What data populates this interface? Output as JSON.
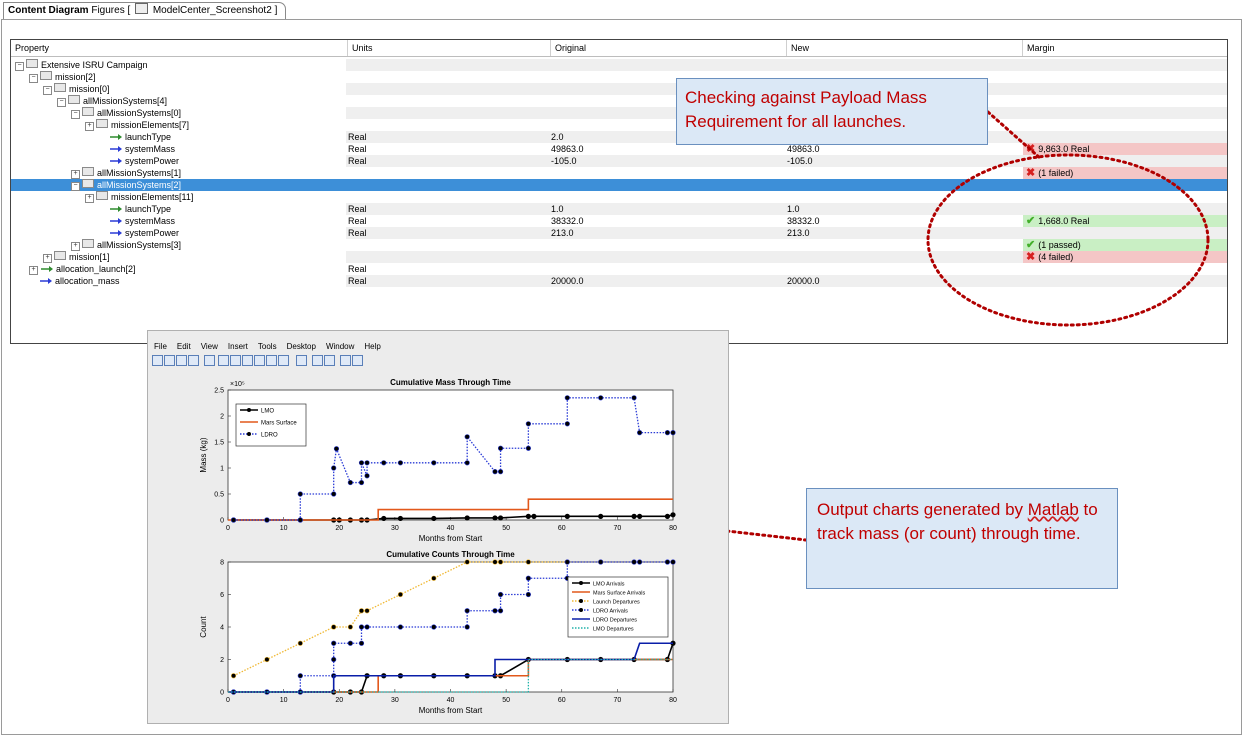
{
  "tab": {
    "bold_label": "Content Diagram",
    "label": "Figures [",
    "doc_name": "ModelCenter_Screenshot2",
    "close": "]"
  },
  "table": {
    "columns": [
      "Property",
      "Units",
      "Original",
      "New",
      "Margin"
    ],
    "rows": [
      {
        "label": "Extensive ISRU Campaign",
        "units": "",
        "original": "",
        "new": "",
        "margin": ""
      },
      {
        "label": "mission[2]",
        "units": "",
        "original": "",
        "new": "",
        "margin": ""
      },
      {
        "label": "mission[0]",
        "units": "",
        "original": "",
        "new": "",
        "margin": ""
      },
      {
        "label": "allMissionSystems[4]",
        "units": "",
        "original": "",
        "new": "",
        "margin": ""
      },
      {
        "label": "allMissionSystems[0]",
        "units": "",
        "original": "",
        "new": "",
        "margin": ""
      },
      {
        "label": "missionElements[7]",
        "units": "",
        "original": "",
        "new": "",
        "margin": ""
      },
      {
        "label": "launchType",
        "units": "Real",
        "original": "2.0",
        "new": "2.0",
        "margin": ""
      },
      {
        "label": "systemMass",
        "units": "Real",
        "original": "49863.0",
        "new": "49863.0",
        "margin": "9,863.0 Real"
      },
      {
        "label": "systemPower",
        "units": "Real",
        "original": "-105.0",
        "new": "-105.0",
        "margin": ""
      },
      {
        "label": "allMissionSystems[1]",
        "units": "",
        "original": "",
        "new": "",
        "margin": "(1 failed)"
      },
      {
        "label": "allMissionSystems[2]",
        "units": "",
        "original": "",
        "new": "",
        "margin": ""
      },
      {
        "label": "missionElements[11]",
        "units": "",
        "original": "",
        "new": "",
        "margin": ""
      },
      {
        "label": "launchType",
        "units": "Real",
        "original": "1.0",
        "new": "1.0",
        "margin": ""
      },
      {
        "label": "systemMass",
        "units": "Real",
        "original": "38332.0",
        "new": "38332.0",
        "margin": "1,668.0 Real"
      },
      {
        "label": "systemPower",
        "units": "Real",
        "original": "213.0",
        "new": "213.0",
        "margin": ""
      },
      {
        "label": "allMissionSystems[3]",
        "units": "",
        "original": "",
        "new": "",
        "margin": "(1 passed)"
      },
      {
        "label": "mission[1]",
        "units": "",
        "original": "",
        "new": "",
        "margin": "(4 failed)"
      },
      {
        "label": "allocation_launch[2]",
        "units": "Real",
        "original": "",
        "new": "",
        "margin": ""
      },
      {
        "label": "allocation_mass",
        "units": "Real",
        "original": "20000.0",
        "new": "20000.0",
        "margin": ""
      }
    ]
  },
  "callouts": {
    "payload": "Checking against Payload Mass Requirement for all launches.",
    "matlab_1": "Output charts generated by",
    "matlab_word": "Matlab",
    "matlab_2": " to track mass (or count) through time."
  },
  "matlab": {
    "menu": [
      "File",
      "Edit",
      "View",
      "Insert",
      "Tools",
      "Desktop",
      "Window",
      "Help"
    ]
  },
  "colors": {
    "selection": "#3d8fd8",
    "fail": "#f4c6c6",
    "pass": "#c9efc4",
    "callout_text": "#c00000",
    "callout_bg": "#dbe8f6"
  },
  "chart_data": [
    {
      "type": "line",
      "title": "Cumulative Mass Through Time",
      "xlabel": "Months from Start",
      "ylabel": "Mass (kg)",
      "y_exponent": "×10⁵",
      "xlim": [
        0,
        80
      ],
      "ylim": [
        0,
        2.5
      ],
      "xticks": [
        "0",
        "10",
        "20",
        "30",
        "40",
        "50",
        "60",
        "70",
        "80"
      ],
      "yticks": [
        "0",
        "0.5",
        "1",
        "1.5",
        "2",
        "2.5"
      ],
      "legend_position": "top-left",
      "series": [
        {
          "name": "LMO",
          "color": "#000000",
          "style": "solid",
          "markers": true,
          "points": [
            [
              1,
              0
            ],
            [
              7,
              0
            ],
            [
              13,
              0
            ],
            [
              19,
              0
            ],
            [
              20,
              0
            ],
            [
              22,
              0
            ],
            [
              24,
              0
            ],
            [
              25,
              0
            ],
            [
              28,
              0.03
            ],
            [
              31,
              0.03
            ],
            [
              37,
              0.03
            ],
            [
              43,
              0.04
            ],
            [
              48,
              0.04
            ],
            [
              49,
              0.04
            ],
            [
              54,
              0.07
            ],
            [
              55,
              0.07
            ],
            [
              61,
              0.07
            ],
            [
              67,
              0.07
            ],
            [
              73,
              0.07
            ],
            [
              74,
              0.07
            ],
            [
              79,
              0.07
            ],
            [
              80,
              0.1
            ]
          ]
        },
        {
          "name": "Mars Surface",
          "color": "#e2581b",
          "style": "solid",
          "markers": false,
          "points": [
            [
              0,
              0
            ],
            [
              27,
              0
            ],
            [
              27,
              0.2
            ],
            [
              54,
              0.2
            ],
            [
              54,
              0.4
            ],
            [
              80,
              0.4
            ]
          ]
        },
        {
          "name": "LDRO",
          "color": "#2a3bd6",
          "style": "dotted",
          "markers": true,
          "points": [
            [
              1,
              0
            ],
            [
              7,
              0
            ],
            [
              13,
              0
            ],
            [
              13,
              0.5
            ],
            [
              19,
              0.5
            ],
            [
              19,
              1.0
            ],
            [
              19.5,
              1.37
            ],
            [
              22,
              0.72
            ],
            [
              24,
              0.72
            ],
            [
              24,
              1.1
            ],
            [
              25,
              0.85
            ],
            [
              25,
              1.1
            ],
            [
              28,
              1.1
            ],
            [
              31,
              1.1
            ],
            [
              37,
              1.1
            ],
            [
              43,
              1.1
            ],
            [
              43,
              1.6
            ],
            [
              48,
              0.93
            ],
            [
              49,
              0.93
            ],
            [
              49,
              1.38
            ],
            [
              54,
              1.38
            ],
            [
              54,
              1.85
            ],
            [
              61,
              1.85
            ],
            [
              61,
              2.35
            ],
            [
              67,
              2.35
            ],
            [
              73,
              2.35
            ],
            [
              74,
              1.68
            ],
            [
              79,
              1.68
            ],
            [
              80,
              1.68
            ]
          ]
        }
      ]
    },
    {
      "type": "line",
      "title": "Cumulative Counts Through Time",
      "xlabel": "Months from Start",
      "ylabel": "Count",
      "xlim": [
        0,
        80
      ],
      "ylim": [
        0,
        8
      ],
      "xticks": [
        "0",
        "10",
        "20",
        "30",
        "40",
        "50",
        "60",
        "70",
        "80"
      ],
      "yticks": [
        "0",
        "2",
        "4",
        "6",
        "8"
      ],
      "legend_position": "right",
      "series": [
        {
          "name": "LMO Arrivals",
          "color": "#000000",
          "style": "solid",
          "markers": true,
          "points": [
            [
              1,
              0
            ],
            [
              7,
              0
            ],
            [
              13,
              0
            ],
            [
              19,
              0
            ],
            [
              22,
              0
            ],
            [
              24,
              0
            ],
            [
              25,
              1
            ],
            [
              28,
              1
            ],
            [
              31,
              1
            ],
            [
              37,
              1
            ],
            [
              43,
              1
            ],
            [
              48,
              1
            ],
            [
              49,
              1
            ],
            [
              54,
              2
            ],
            [
              61,
              2
            ],
            [
              67,
              2
            ],
            [
              73,
              2
            ],
            [
              79,
              2
            ],
            [
              80,
              3
            ]
          ]
        },
        {
          "name": "Mars Surface Arrivals",
          "color": "#e2581b",
          "style": "solid",
          "markers": false,
          "points": [
            [
              0,
              0
            ],
            [
              27,
              0
            ],
            [
              27,
              1
            ],
            [
              54,
              1
            ],
            [
              54,
              2
            ],
            [
              80,
              2
            ]
          ]
        },
        {
          "name": "Launch Departures",
          "color": "#f0b832",
          "style": "dotted",
          "markers": true,
          "points": [
            [
              1,
              1
            ],
            [
              7,
              2
            ],
            [
              13,
              3
            ],
            [
              19,
              4
            ],
            [
              22,
              4
            ],
            [
              24,
              5
            ],
            [
              25,
              5
            ],
            [
              31,
              6
            ],
            [
              37,
              7
            ],
            [
              43,
              8
            ],
            [
              48,
              8
            ],
            [
              49,
              8
            ],
            [
              54,
              8
            ],
            [
              61,
              8
            ],
            [
              67,
              8
            ],
            [
              73,
              8
            ],
            [
              80,
              8
            ]
          ]
        },
        {
          "name": "LDRO Arrivals",
          "color": "#2a3bd6",
          "style": "dotted",
          "markers": true,
          "points": [
            [
              1,
              0
            ],
            [
              7,
              0
            ],
            [
              13,
              0
            ],
            [
              13,
              1
            ],
            [
              19,
              1
            ],
            [
              19,
              2
            ],
            [
              19,
              3
            ],
            [
              22,
              3
            ],
            [
              24,
              3
            ],
            [
              24,
              4
            ],
            [
              25,
              4
            ],
            [
              31,
              4
            ],
            [
              37,
              4
            ],
            [
              43,
              4
            ],
            [
              43,
              5
            ],
            [
              48,
              5
            ],
            [
              49,
              5
            ],
            [
              49,
              6
            ],
            [
              54,
              6
            ],
            [
              54,
              7
            ],
            [
              61,
              7
            ],
            [
              61,
              8
            ],
            [
              67,
              8
            ],
            [
              73,
              8
            ],
            [
              74,
              8
            ],
            [
              79,
              8
            ],
            [
              80,
              8
            ]
          ]
        },
        {
          "name": "LDRO Departures",
          "color": "#0a1ea8",
          "style": "solid",
          "markers": false,
          "points": [
            [
              0,
              0
            ],
            [
              19,
              0
            ],
            [
              19,
              1
            ],
            [
              48,
              1
            ],
            [
              48,
              2
            ],
            [
              73,
              2
            ],
            [
              74,
              3
            ],
            [
              80,
              3
            ]
          ]
        },
        {
          "name": "LMO Departures",
          "color": "#20b2aa",
          "style": "dotted",
          "markers": false,
          "points": [
            [
              0,
              0
            ],
            [
              54,
              0
            ],
            [
              54,
              2
            ],
            [
              80,
              2
            ]
          ]
        }
      ]
    }
  ]
}
